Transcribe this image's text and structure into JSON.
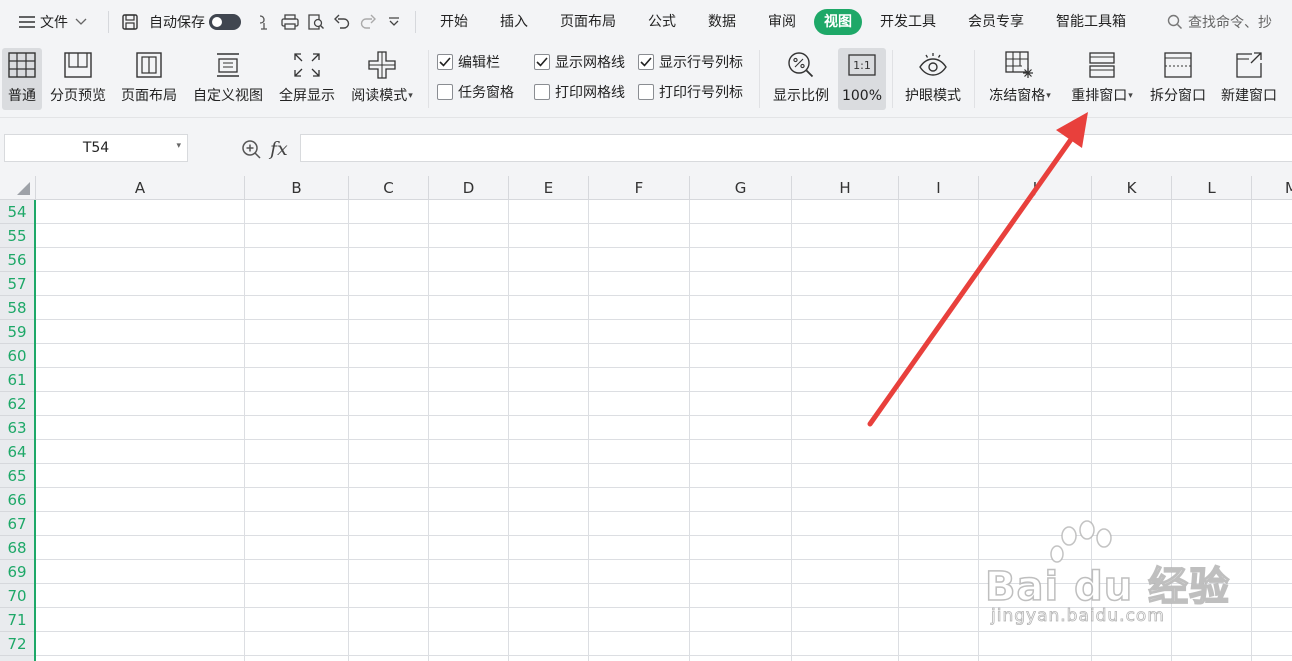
{
  "menubar": {
    "file_label": "文件",
    "autosave_label": "自动保存",
    "tabs": [
      {
        "label": "开始",
        "active": false
      },
      {
        "label": "插入",
        "active": false
      },
      {
        "label": "页面布局",
        "active": false
      },
      {
        "label": "公式",
        "active": false
      },
      {
        "label": "数据",
        "active": false
      },
      {
        "label": "审阅",
        "active": false
      },
      {
        "label": "视图",
        "active": true
      },
      {
        "label": "开发工具",
        "active": false
      },
      {
        "label": "会员专享",
        "active": false
      },
      {
        "label": "智能工具箱",
        "active": false
      }
    ],
    "search_placeholder": "查找命令、抄"
  },
  "ribbon": {
    "normal": "普通",
    "page_break_preview": "分页预览",
    "page_layout": "页面布局",
    "custom_view": "自定义视图",
    "full_screen": "全屏显示",
    "reading_mode": "阅读模式",
    "checkboxes": {
      "formula_bar": {
        "label": "编辑栏",
        "checked": true
      },
      "task_pane": {
        "label": "任务窗格",
        "checked": false
      },
      "show_gridlines": {
        "label": "显示网格线",
        "checked": true
      },
      "print_gridlines": {
        "label": "打印网格线",
        "checked": false
      },
      "show_headings": {
        "label": "显示行号列标",
        "checked": true
      },
      "print_headings": {
        "label": "打印行号列标",
        "checked": false
      }
    },
    "zoom": "显示比例",
    "zoom_100": "100%",
    "zoom_100_icon_text": "1:1",
    "eye_protection": "护眼模式",
    "freeze_panes": "冻结窗格",
    "arrange_windows": "重排窗口",
    "split_window": "拆分窗口",
    "new_window": "新建窗口"
  },
  "formula_bar": {
    "cell_ref": "T54",
    "fx_label": "fx",
    "value": ""
  },
  "sheet": {
    "columns": [
      "A",
      "B",
      "C",
      "D",
      "E",
      "F",
      "G",
      "H",
      "I",
      "J",
      "K",
      "L",
      "M"
    ],
    "rows": [
      "54",
      "55",
      "56",
      "57",
      "58",
      "59",
      "60",
      "61",
      "62",
      "63",
      "64",
      "65",
      "66",
      "67",
      "68",
      "69",
      "70",
      "71",
      "72"
    ]
  },
  "colors": {
    "accent": "#1ea868",
    "annotation_arrow": "#e8403c"
  },
  "watermark": {
    "logo": "Bai du 经验",
    "url": "jingyan.baidu.com"
  }
}
